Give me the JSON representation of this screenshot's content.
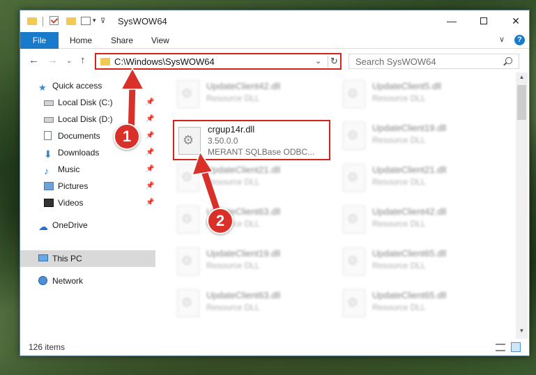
{
  "window": {
    "title": "SysWOW64",
    "minimize": "—",
    "maximize": "",
    "close": "✕"
  },
  "ribbon": {
    "tabs": [
      "File",
      "Home",
      "Share",
      "View"
    ],
    "chevron": "∨",
    "help": "?"
  },
  "nav": {
    "back": "←",
    "forward": "→",
    "recent": "⌄",
    "up": "↑",
    "address": "C:\\Windows\\SysWOW64",
    "address_dropdown": "⌄",
    "refresh": "↻",
    "search_placeholder": "Search SysWOW64"
  },
  "sidebar": {
    "items": [
      {
        "label": "Quick access",
        "icon": "star-icon",
        "glyph": "★",
        "pinned": false
      },
      {
        "label": "Local Disk (C:)",
        "icon": "drive-icon",
        "glyph": "",
        "pinned": true
      },
      {
        "label": "Local Disk (D:)",
        "icon": "drive-icon",
        "glyph": "",
        "pinned": true
      },
      {
        "label": "Documents",
        "icon": "documents-icon",
        "glyph": "",
        "pinned": true
      },
      {
        "label": "Downloads",
        "icon": "download-icon",
        "glyph": "⬇",
        "pinned": true
      },
      {
        "label": "Music",
        "icon": "music-icon",
        "glyph": "♪",
        "pinned": true
      },
      {
        "label": "Pictures",
        "icon": "pictures-icon",
        "glyph": "",
        "pinned": true
      },
      {
        "label": "Videos",
        "icon": "videos-icon",
        "glyph": "",
        "pinned": true
      },
      {
        "label": "OneDrive",
        "icon": "cloud-icon",
        "glyph": "☁",
        "pinned": false
      },
      {
        "label": "This PC",
        "icon": "computer-icon",
        "glyph": "",
        "pinned": false
      },
      {
        "label": "Network",
        "icon": "network-icon",
        "glyph": "",
        "pinned": false
      }
    ],
    "pin_glyph": "📌"
  },
  "files": {
    "highlighted": {
      "name": "crgup14r.dll",
      "version": "3.50.0.0",
      "description": "MERANT SQLBase ODBC..."
    },
    "blurred": [
      {
        "name": "UpdateClient42.dll",
        "type": "Resource DLL"
      },
      {
        "name": "UpdateClient5.dll",
        "type": "Resource DLL"
      },
      {
        "name": "UpdateClient19.dll",
        "type": "Resource DLL"
      },
      {
        "name": "UpdateClient21.dll",
        "type": "Resource DLL"
      },
      {
        "name": "UpdateClient21.dll",
        "type": "Resource DLL"
      },
      {
        "name": "UpdateClient63.dll",
        "type": "Resource DLL"
      },
      {
        "name": "UpdateClient42.dll",
        "type": "Resource DLL"
      },
      {
        "name": "UpdateClient19.dll",
        "type": "Resource DLL"
      },
      {
        "name": "UpdateClient65.dll",
        "type": "Resource DLL"
      },
      {
        "name": "UpdateClient63.dll",
        "type": "Resource DLL"
      },
      {
        "name": "UpdateClient65.dll",
        "type": "Resource DLL"
      }
    ]
  },
  "status": {
    "item_count": "126 items"
  },
  "annotations": {
    "step1": "1",
    "step2": "2",
    "color": "#d9302a"
  },
  "colors": {
    "accent": "#1979ca",
    "highlight_border": "#d6211a"
  }
}
